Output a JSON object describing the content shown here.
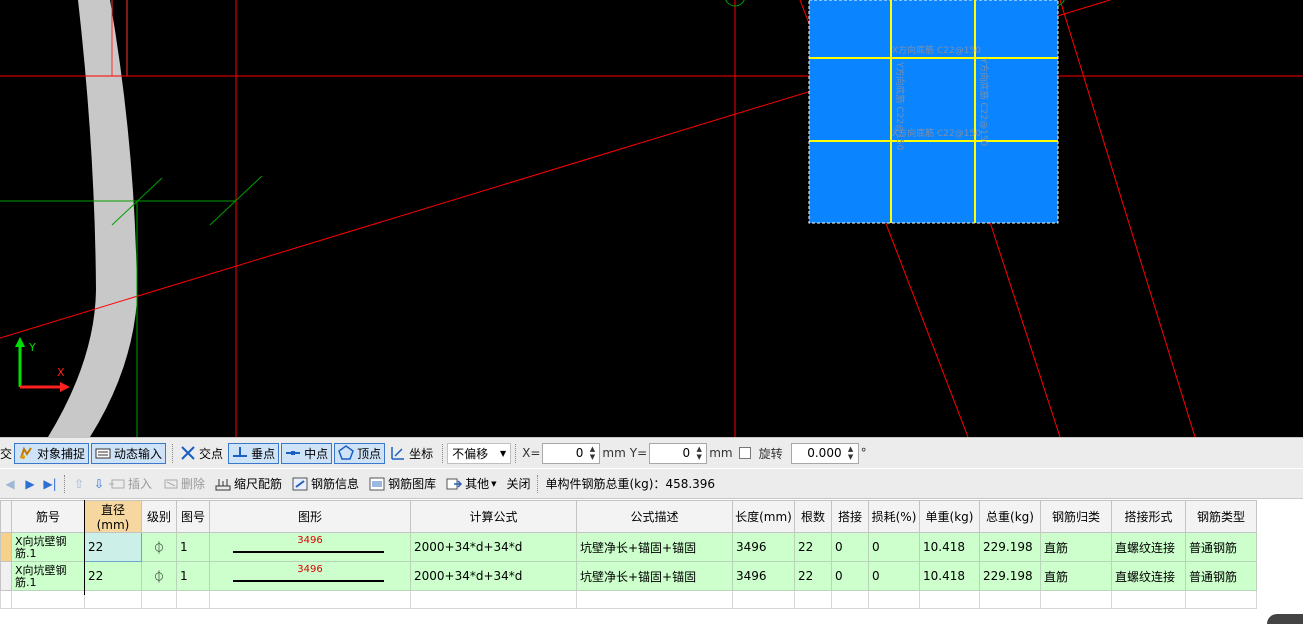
{
  "canvas": {
    "background": "#000000",
    "axis": {
      "y_label": "Y",
      "x_label": "X"
    },
    "labels": [
      {
        "id": "t1",
        "text": "X方向底筋 C22@150"
      },
      {
        "id": "t2",
        "text": "Y方向底筋 C22@150"
      },
      {
        "id": "t3",
        "text": "Y方向底筋 C22@150"
      },
      {
        "id": "t4",
        "text": "X方向底筋 C22@150"
      }
    ],
    "colors": {
      "slab": "#0a84ff",
      "rebar": "#ffff00",
      "axis_line": "#ff0000",
      "wall": "#c8c8c8",
      "snap": "#00aa00"
    }
  },
  "snapbar": {
    "ortho": "正交",
    "object_snap": "对象捕捉",
    "dynamic_input": "动态输入",
    "intersection": "交点",
    "perpendicular": "垂点",
    "midpoint": "中点",
    "vertex": "顶点",
    "coordinate": "坐标",
    "offset_mode": "不偏移",
    "x_label": "X=",
    "x_value": "0",
    "x_unit": "mm",
    "y_label": "Y=",
    "y_value": "0",
    "y_unit": "mm",
    "rotate": "旋转",
    "rotate_value": "0.000",
    "degree": "°"
  },
  "rebarbar": {
    "insert": "插入",
    "delete": "删除",
    "scale_rebar": "缩尺配筋",
    "rebar_info": "钢筋信息",
    "rebar_library": "钢筋图库",
    "other": "其他",
    "close": "关闭",
    "total_label": "单构件钢筋总重(kg)：",
    "total_value": "458.396"
  },
  "table": {
    "headers": [
      "筋号",
      "直径(mm)",
      "级别",
      "图号",
      "图形",
      "计算公式",
      "公式描述",
      "长度(mm)",
      "根数",
      "搭接",
      "损耗(%)",
      "单重(kg)",
      "总重(kg)",
      "钢筋归类",
      "搭接形式",
      "钢筋类型"
    ],
    "rows": [
      {
        "name": "X向坑壁钢筋.1",
        "diameter": "22",
        "grade": "⏀",
        "figure_no": "1",
        "shape_dim": "3496",
        "formula": "2000+34*d+34*d",
        "description": "坑壁净长+锚固+锚固",
        "length": "3496",
        "count": "22",
        "lap": "0",
        "loss": "0",
        "unit_weight": "10.418",
        "total_weight": "229.198",
        "category": "直筋",
        "lap_type": "直螺纹连接",
        "rebar_type": "普通钢筋"
      },
      {
        "name": "X向坑壁钢筋.1",
        "diameter": "22",
        "grade": "⏀",
        "figure_no": "1",
        "shape_dim": "3496",
        "formula": "2000+34*d+34*d",
        "description": "坑壁净长+锚固+锚固",
        "length": "3496",
        "count": "22",
        "lap": "0",
        "loss": "0",
        "unit_weight": "10.418",
        "total_weight": "229.198",
        "category": "直筋",
        "lap_type": "直螺纹连接",
        "rebar_type": "普通钢筋"
      }
    ]
  }
}
